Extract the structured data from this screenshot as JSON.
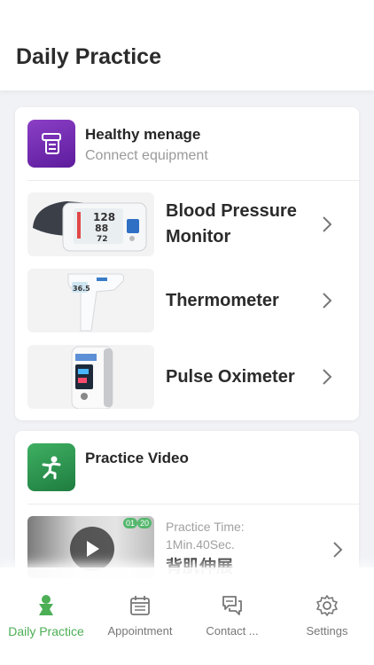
{
  "header": {
    "title": "Daily Practice"
  },
  "health_card": {
    "title": "Healthy menage",
    "subtitle": "Connect equipment",
    "devices": [
      {
        "label": "Blood Pressure Monitor",
        "image_icon": "blood-pressure-monitor"
      },
      {
        "label": "Thermometer",
        "image_icon": "thermometer"
      },
      {
        "label": "Pulse Oximeter",
        "image_icon": "pulse-oximeter"
      }
    ]
  },
  "video_card": {
    "title": "Practice Video",
    "video": {
      "time_label": "Practice Time:",
      "time_value": "1Min.40Sec.",
      "name": "背肌伸展",
      "badges": [
        "01",
        "20"
      ]
    }
  },
  "tabbar": {
    "tabs": [
      {
        "label": "Daily Practice",
        "icon": "person-practice-icon",
        "active": true
      },
      {
        "label": "Appointment",
        "icon": "calendar-icon",
        "active": false
      },
      {
        "label": "Contact ...",
        "icon": "chat-icon",
        "active": false
      },
      {
        "label": "Settings",
        "icon": "gear-icon",
        "active": false
      }
    ]
  },
  "colors": {
    "accent": "#4cae55",
    "purple": "#6a26a8",
    "green": "#2e9a50"
  }
}
